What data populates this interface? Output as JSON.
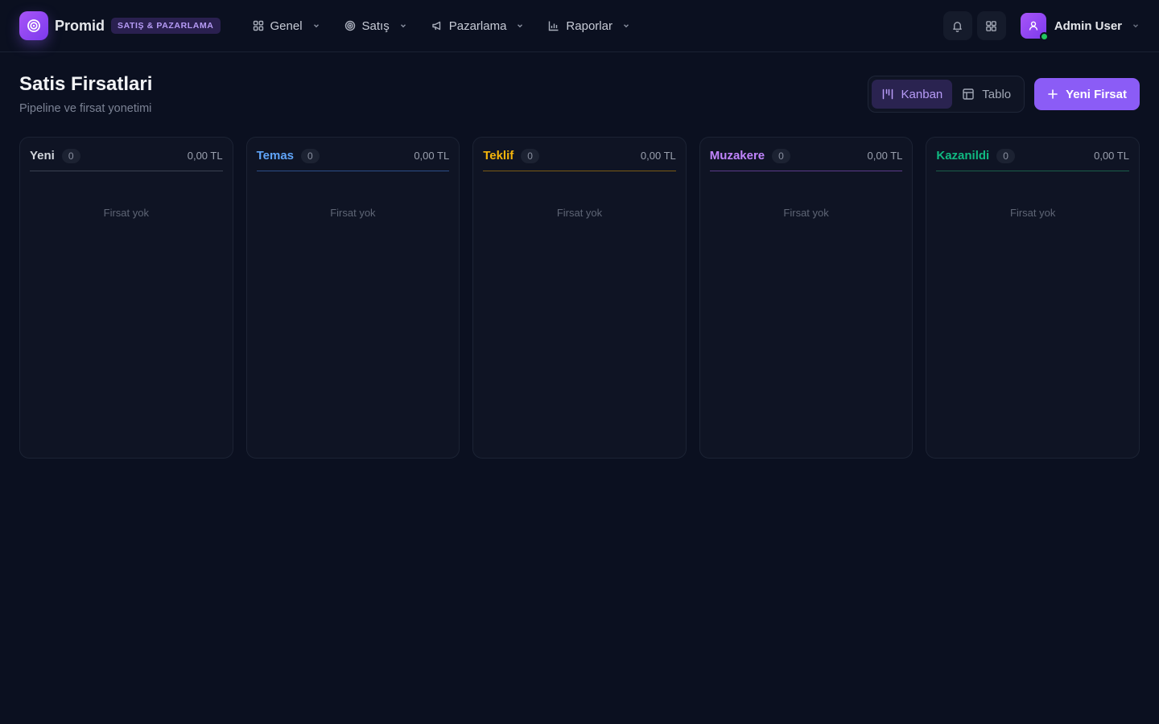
{
  "brand": {
    "name": "Promid",
    "badge": "SATIŞ & PAZARLAMA"
  },
  "nav": [
    {
      "label": "Genel",
      "icon": "grid-icon"
    },
    {
      "label": "Satış",
      "icon": "target-icon"
    },
    {
      "label": "Pazarlama",
      "icon": "megaphone-icon"
    },
    {
      "label": "Raporlar",
      "icon": "bar-chart-icon"
    }
  ],
  "user": {
    "name": "Admin User",
    "status": "online"
  },
  "page": {
    "title": "Satis Firsatlari",
    "subtitle": "Pipeline ve firsat yonetimi"
  },
  "view_toggle": {
    "kanban": "Kanban",
    "table": "Tablo",
    "active": "kanban"
  },
  "new_button": "Yeni Firsat",
  "columns": [
    {
      "title": "Yeni",
      "count": "0",
      "total": "0,00 TL",
      "empty": "Firsat yok",
      "color": "#d1d5db",
      "line": "#3a4152"
    },
    {
      "title": "Temas",
      "count": "0",
      "total": "0,00 TL",
      "empty": "Firsat yok",
      "color": "#60a5fa",
      "line": "#2c4e88"
    },
    {
      "title": "Teklif",
      "count": "0",
      "total": "0,00 TL",
      "empty": "Firsat yok",
      "color": "#f5b50b",
      "line": "#7a5a14"
    },
    {
      "title": "Muzakere",
      "count": "0",
      "total": "0,00 TL",
      "empty": "Firsat yok",
      "color": "#c084fc",
      "line": "#5b3b8a"
    },
    {
      "title": "Kazanildi",
      "count": "0",
      "total": "0,00 TL",
      "empty": "Firsat yok",
      "color": "#10b981",
      "line": "#1a5e4a"
    }
  ]
}
